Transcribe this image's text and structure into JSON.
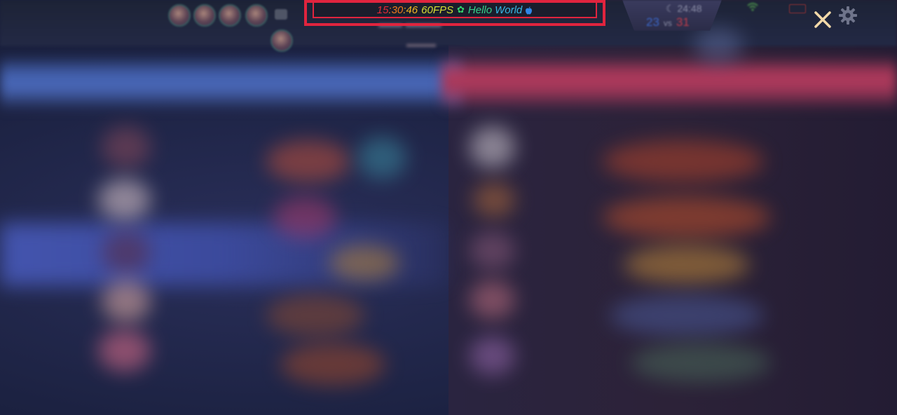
{
  "overlay": {
    "hour": "15",
    "sep1": ":",
    "minute": "30",
    "sep2": ":",
    "second": "46",
    "fps": "60FPS",
    "flower_glyph": "✿",
    "hello": "Hello",
    "world": "World",
    "frame_color": "#e0243e"
  },
  "match": {
    "timer": "24:48",
    "blue_score": "23",
    "vs_label": "vs",
    "red_score": "31",
    "blue_color": "#3b67c8",
    "red_color": "#c03c4a"
  },
  "icons": {
    "close": "close-icon",
    "settings": "gear-icon",
    "apple": "apple-icon",
    "flower": "flower-icon",
    "chat": "chat-icon",
    "wifi": "wifi-icon",
    "battery": "battery-icon"
  }
}
